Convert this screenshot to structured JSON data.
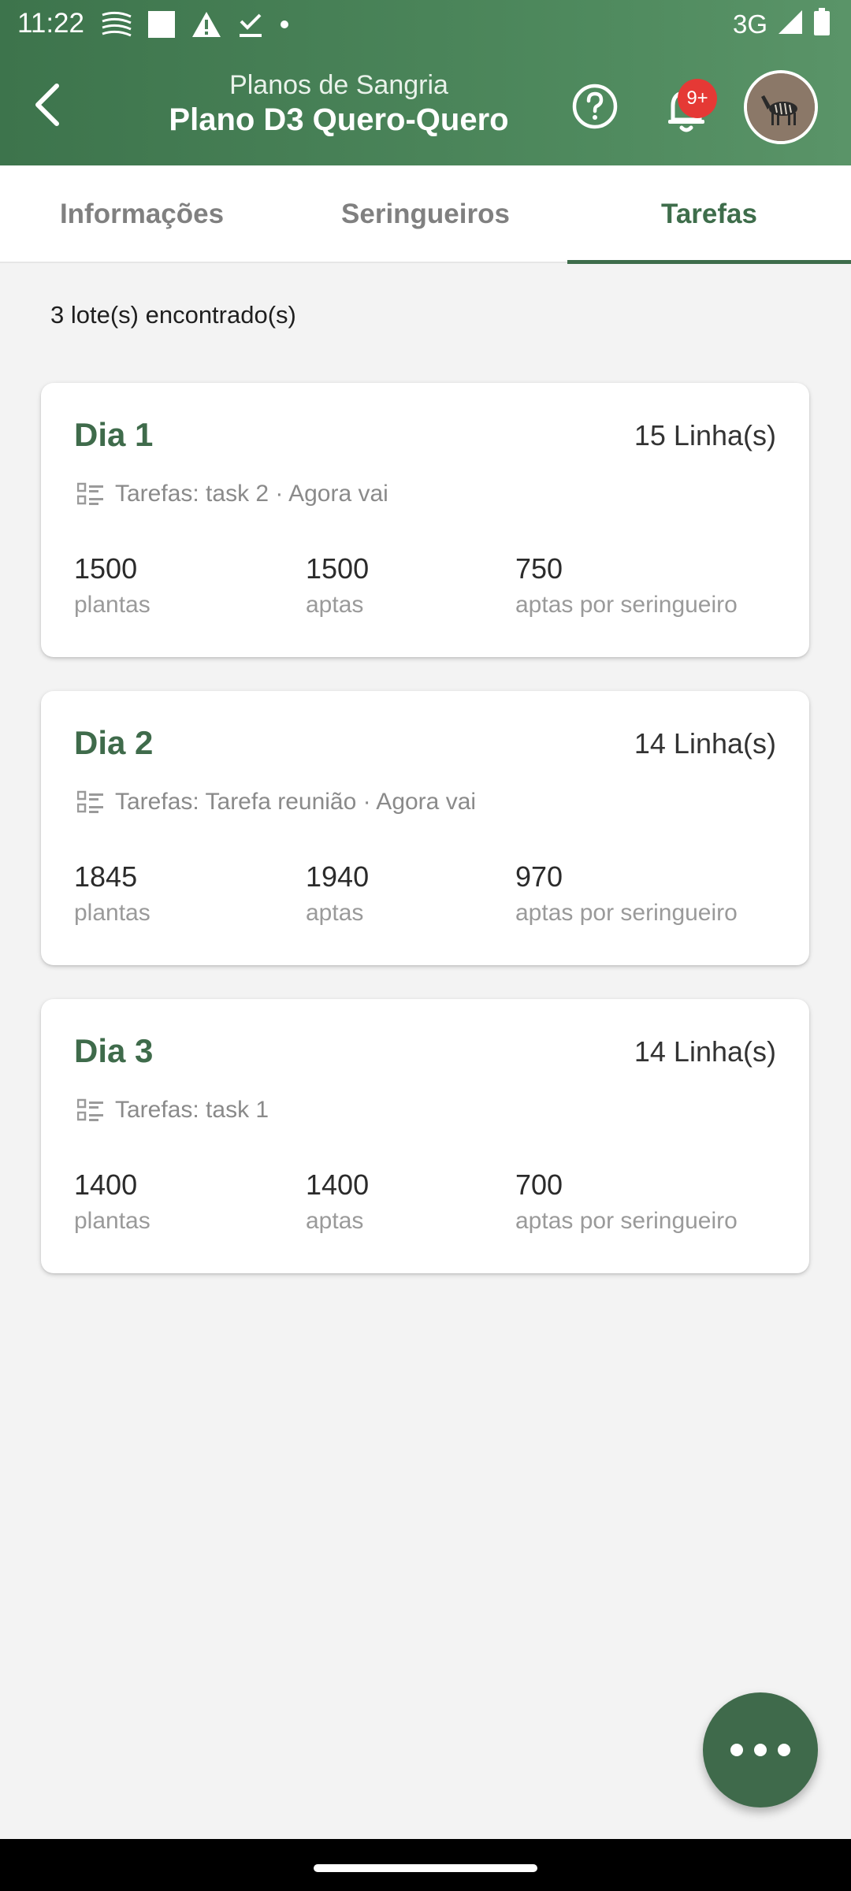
{
  "status_bar": {
    "time": "11:22",
    "network": "3G"
  },
  "app_bar": {
    "subtitle": "Planos de Sangria",
    "title": "Plano D3 Quero-Quero",
    "notification_badge": "9+"
  },
  "tabs": [
    {
      "label": "Informações",
      "active": false
    },
    {
      "label": "Seringueiros",
      "active": false
    },
    {
      "label": "Tarefas",
      "active": true
    }
  ],
  "result_count": "3 lote(s) encontrado(s)",
  "cards": [
    {
      "title": "Dia 1",
      "lines": "15 Linha(s)",
      "tasks": "Tarefas: task 2 · Agora vai",
      "stats": [
        {
          "value": "1500",
          "label": "plantas"
        },
        {
          "value": "1500",
          "label": "aptas"
        },
        {
          "value": "750",
          "label": "aptas por seringueiro"
        }
      ]
    },
    {
      "title": "Dia 2",
      "lines": "14 Linha(s)",
      "tasks": "Tarefas: Tarefa reunião · Agora vai",
      "stats": [
        {
          "value": "1845",
          "label": "plantas"
        },
        {
          "value": "1940",
          "label": "aptas"
        },
        {
          "value": "970",
          "label": "aptas por seringueiro"
        }
      ]
    },
    {
      "title": "Dia 3",
      "lines": "14 Linha(s)",
      "tasks": "Tarefas: task 1",
      "stats": [
        {
          "value": "1400",
          "label": "plantas"
        },
        {
          "value": "1400",
          "label": "aptas"
        },
        {
          "value": "700",
          "label": "aptas por seringueiro"
        }
      ]
    }
  ],
  "icons": {
    "back": "arrow-back-icon",
    "help": "help-circle-icon",
    "notifications": "bell-icon",
    "avatar": "zebra-avatar",
    "tasks": "checklist-icon",
    "fab": "more-horizontal-icon"
  },
  "colors": {
    "primary": "#3e6d4b",
    "badge": "#e53935",
    "background": "#f3f3f3"
  }
}
